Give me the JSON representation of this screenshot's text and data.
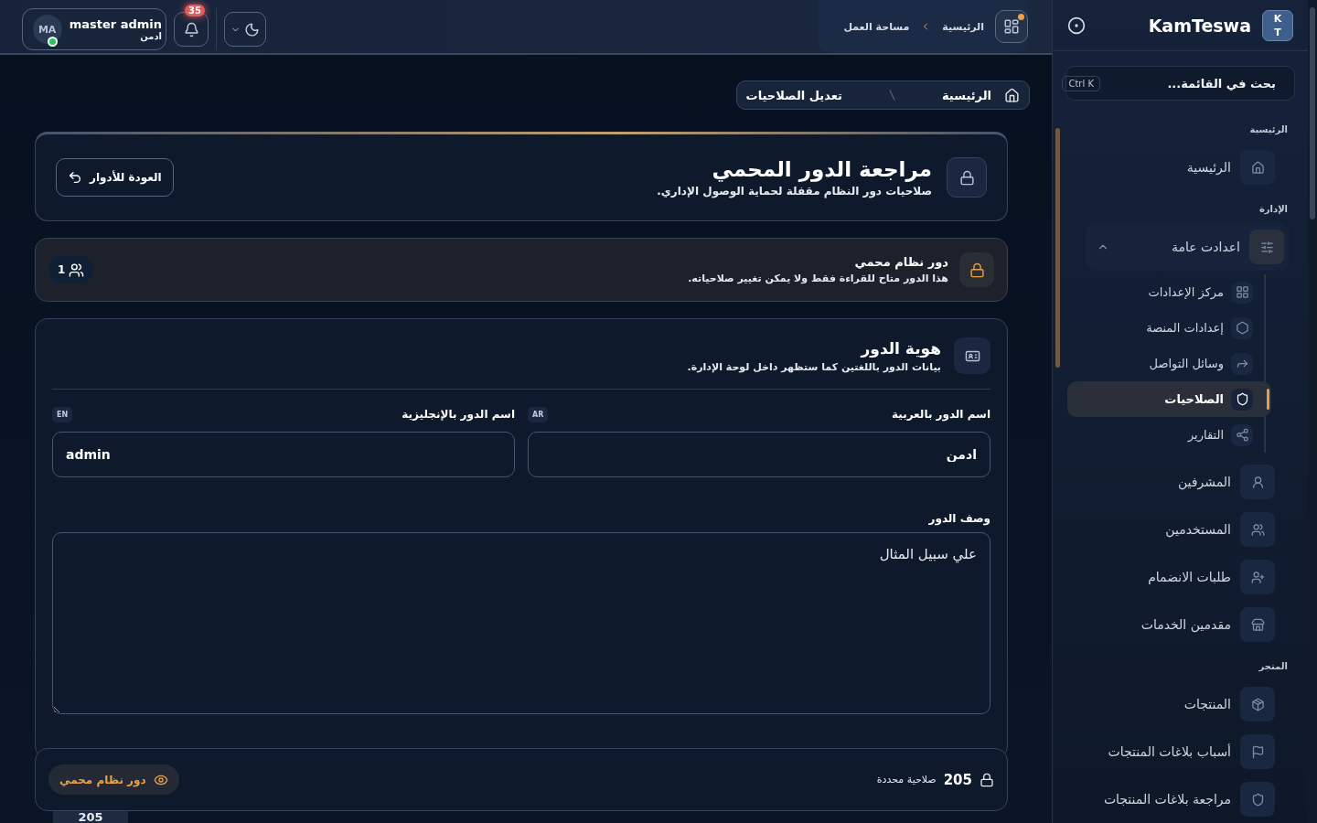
{
  "sidebar": {
    "logo_letters": [
      "K",
      "T"
    ],
    "brand": "KamTeswa",
    "search": {
      "placeholder": "بحث في القائمة...",
      "shortcut": "Ctrl K"
    },
    "sections": [
      {
        "title": "الرئيسية",
        "items": [
          {
            "label": "الرئيسية",
            "selected": false
          }
        ]
      },
      {
        "title": "الإدارة",
        "items": [
          {
            "label": "اعدادت عامة",
            "selected": false,
            "expanded": true,
            "children": [
              {
                "label": "مركز الإعدادات",
                "selected": false
              },
              {
                "label": "إعدادات المنصة",
                "selected": false
              },
              {
                "label": "وسائل التواصل",
                "selected": false
              },
              {
                "label": "الصلاحيات",
                "selected": true
              },
              {
                "label": "التقارير",
                "selected": false
              }
            ]
          },
          {
            "label": "المشرفين",
            "selected": false
          },
          {
            "label": "المستخدمين",
            "selected": false
          },
          {
            "label": "طلبات الانضمام",
            "selected": false
          },
          {
            "label": "مقدمين الخدمات",
            "selected": false
          }
        ]
      },
      {
        "title": "المتجر",
        "items": [
          {
            "label": "المنتجات",
            "selected": false
          },
          {
            "label": "أسباب بلاغات المنتجات",
            "selected": false
          },
          {
            "label": "مراجعة بلاغات المنتجات",
            "selected": false
          }
        ]
      }
    ]
  },
  "topbar": {
    "breadcrumb": [
      "الرئيسية",
      "مساحة العمل"
    ],
    "notifications": "35",
    "user": {
      "initials": "MA",
      "name": "master admin",
      "role": "ادمن",
      "online": true
    }
  },
  "page": {
    "breadcrumb": [
      "الرئيسية",
      "تعديل الصلاحيات"
    ],
    "title": "مراجعة الدور المحمي",
    "subtitle": "صلاحيات دور النظام مقفلة لحماية الوصول الإداري.",
    "back_button": "العودة للأدوار",
    "notice": {
      "title": "دور نظام محمي",
      "text": "هذا الدور متاح للقراءة فقط ولا يمكن تغيير صلاحياته.",
      "users_count": "1"
    },
    "identity": {
      "title": "هوية الدور",
      "subtitle": "بيانات الدور باللغتين كما ستظهر داخل لوحة الإدارة.",
      "fields": [
        {
          "label": "اسم الدور بالعربية",
          "lang": "AR",
          "value": "ادمن"
        },
        {
          "label": "اسم الدور بالإنجليزية",
          "lang": "EN",
          "value": "admin"
        }
      ],
      "description": {
        "label": "وصف الدور",
        "placeholder": "علي سبيل المثال"
      }
    },
    "footer": {
      "count": "205",
      "count_label": "صلاحية محددة",
      "badge": "دور نظام محمي"
    },
    "next_counter": "205"
  }
}
